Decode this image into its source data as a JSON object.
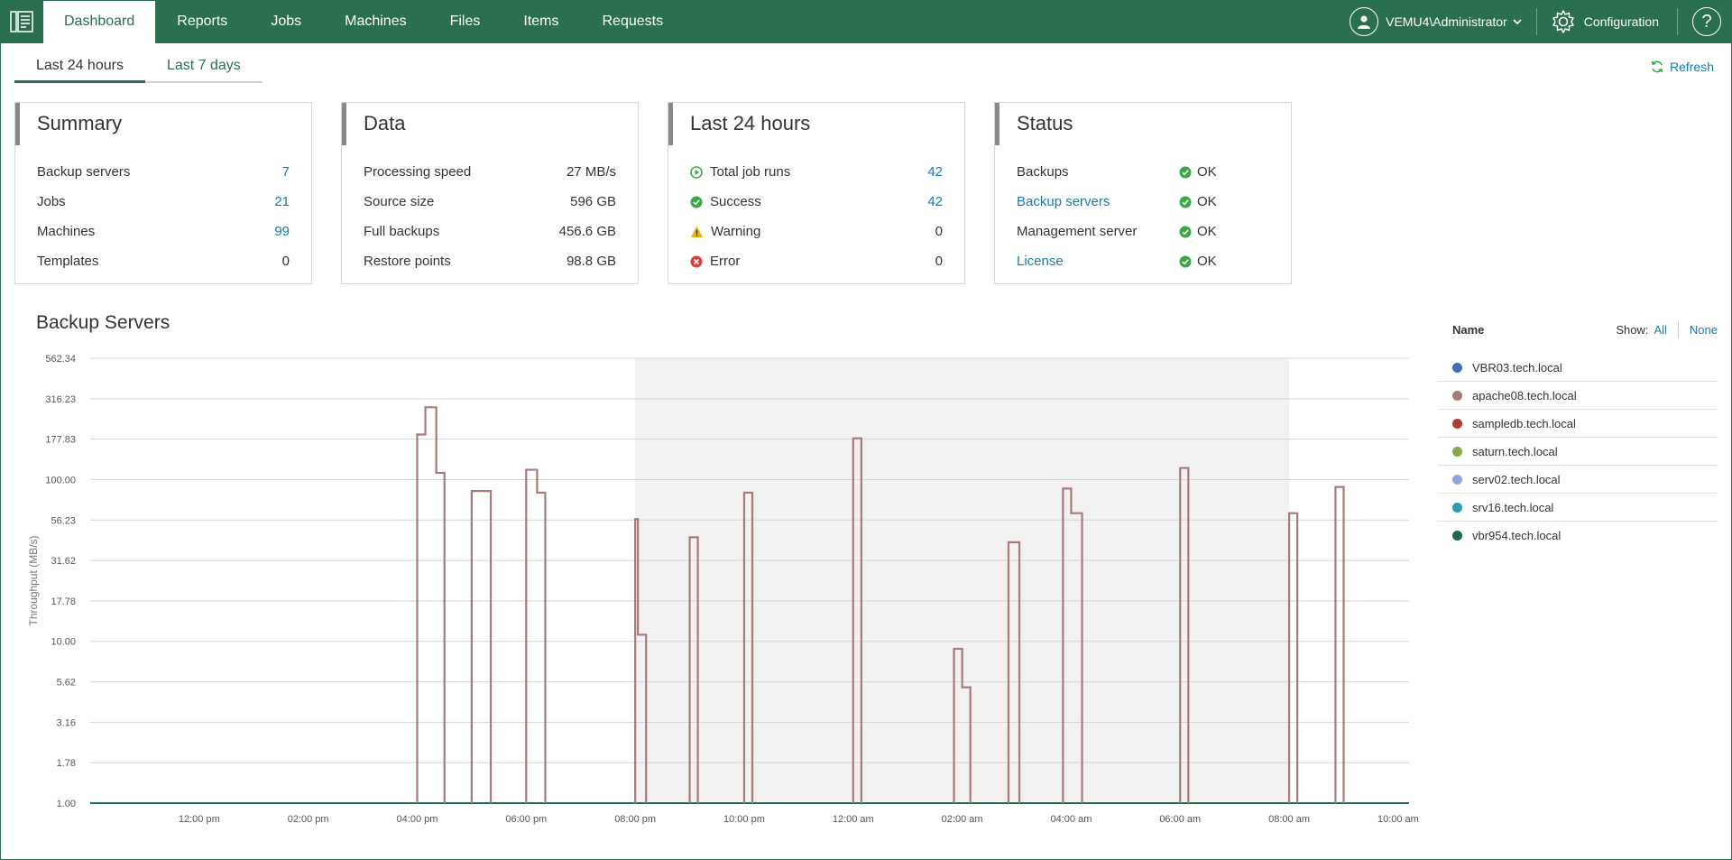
{
  "nav": {
    "logo_icon": "app-logo-icon",
    "items": [
      {
        "label": "Dashboard",
        "active": true
      },
      {
        "label": "Reports"
      },
      {
        "label": "Jobs"
      },
      {
        "label": "Machines"
      },
      {
        "label": "Files"
      },
      {
        "label": "Items"
      },
      {
        "label": "Requests"
      }
    ],
    "user": "VEMU4\\Administrator",
    "configuration": "Configuration",
    "help": "?"
  },
  "period_tabs": [
    "Last 24 hours",
    "Last 7 days"
  ],
  "refresh_label": "Refresh",
  "cards": {
    "summary": {
      "title": "Summary",
      "rows": [
        {
          "label": "Backup servers",
          "value": "7"
        },
        {
          "label": "Jobs",
          "value": "21"
        },
        {
          "label": "Machines",
          "value": "99"
        },
        {
          "label": "Templates",
          "value": "0"
        }
      ]
    },
    "data": {
      "title": "Data",
      "rows": [
        {
          "label": "Processing speed",
          "value": "27 MB/s"
        },
        {
          "label": "Source size",
          "value": "596 GB"
        },
        {
          "label": "Full backups",
          "value": "456.6 GB"
        },
        {
          "label": "Restore points",
          "value": "98.8 GB"
        }
      ]
    },
    "last24": {
      "title": "Last 24 hours",
      "rows": [
        {
          "label": "Total job runs",
          "value": "42",
          "icon": "play-circle-icon"
        },
        {
          "label": "Success",
          "value": "42",
          "icon": "check-circle-icon"
        },
        {
          "label": "Warning",
          "value": "0",
          "icon": "warning-triangle-icon"
        },
        {
          "label": "Error",
          "value": "0",
          "icon": "error-circle-icon"
        }
      ]
    },
    "status": {
      "title": "Status",
      "rows": [
        {
          "label": "Backups",
          "status": "OK"
        },
        {
          "label": "Backup servers",
          "status": "OK"
        },
        {
          "label": "Management server",
          "status": "OK"
        },
        {
          "label": "License",
          "status": "OK"
        }
      ]
    }
  },
  "colors": {
    "brand": "#2a6f4e",
    "link": "#1a7aaf",
    "ok": "#3aa845",
    "series_line": "#a87a7a"
  },
  "chart_section_title": "Backup Servers",
  "legend": {
    "name_header": "Name",
    "show_label": "Show:",
    "all_label": "All",
    "none_label": "None",
    "items": [
      {
        "name": "VBR03.tech.local",
        "color": "#3d6fb0"
      },
      {
        "name": "apache08.tech.local",
        "color": "#a87a7a"
      },
      {
        "name": "sampledb.tech.local",
        "color": "#b33a3a"
      },
      {
        "name": "saturn.tech.local",
        "color": "#88a84a"
      },
      {
        "name": "serv02.tech.local",
        "color": "#8fa8d8"
      },
      {
        "name": "srv16.tech.local",
        "color": "#2f9bb0"
      },
      {
        "name": "vbr954.tech.local",
        "color": "#1f6b46"
      }
    ]
  },
  "chart_data": {
    "type": "line",
    "ylabel": "Throughput (MB/s)",
    "yscale": "log",
    "ylim": [
      1,
      562.34
    ],
    "ytick_labels": [
      "562.34",
      "316.23",
      "177.83",
      "100.00",
      "56.23",
      "31.62",
      "17.78",
      "10.00",
      "5.62",
      "3.16",
      "1.78",
      "1.00"
    ],
    "xtick_labels": [
      "12:00 pm",
      "02:00 pm",
      "04:00 pm",
      "06:00 pm",
      "08:00 pm",
      "10:00 pm",
      "12:00 am",
      "02:00 am",
      "04:00 am",
      "06:00 am",
      "08:00 am",
      "10:00 am"
    ],
    "xlim_hours": [
      -2,
      22.2
    ],
    "highlight_band_hours": [
      8,
      20
    ],
    "series": [
      {
        "name": "apache08.tech.local",
        "segments": [
          {
            "from": 4.0,
            "to": 4.5,
            "steps": [
              [
                4.0,
                190
              ],
              [
                4.15,
                280
              ],
              [
                4.35,
                110
              ]
            ]
          },
          {
            "from": 5.0,
            "to": 5.35,
            "steps": [
              [
                5.0,
                85
              ]
            ]
          },
          {
            "from": 6.0,
            "to": 6.35,
            "steps": [
              [
                6.0,
                115
              ],
              [
                6.2,
                83
              ]
            ]
          },
          {
            "from": 8.0,
            "to": 8.2,
            "steps": [
              [
                8.0,
                57
              ],
              [
                8.05,
                11
              ]
            ]
          },
          {
            "from": 9.0,
            "to": 9.15,
            "steps": [
              [
                9.0,
                44
              ]
            ]
          },
          {
            "from": 10.0,
            "to": 10.15,
            "steps": [
              [
                10.0,
                83
              ]
            ]
          },
          {
            "from": 12.0,
            "to": 12.15,
            "steps": [
              [
                12.0,
                180
              ]
            ]
          },
          {
            "from": 13.85,
            "to": 14.15,
            "steps": [
              [
                13.85,
                9
              ],
              [
                14.0,
                5.2
              ]
            ]
          },
          {
            "from": 14.85,
            "to": 15.05,
            "steps": [
              [
                14.85,
                41
              ]
            ]
          },
          {
            "from": 15.85,
            "to": 16.2,
            "steps": [
              [
                15.85,
                88
              ],
              [
                16.0,
                62
              ]
            ]
          },
          {
            "from": 18.0,
            "to": 18.15,
            "steps": [
              [
                18.0,
                118
              ]
            ]
          },
          {
            "from": 20.0,
            "to": 20.15,
            "steps": [
              [
                20.0,
                62
              ]
            ]
          },
          {
            "from": 20.85,
            "to": 21.0,
            "steps": [
              [
                20.85,
                90
              ]
            ]
          }
        ]
      },
      {
        "name": "vbr954.tech.local",
        "values": "baseline 1.00"
      }
    ]
  }
}
